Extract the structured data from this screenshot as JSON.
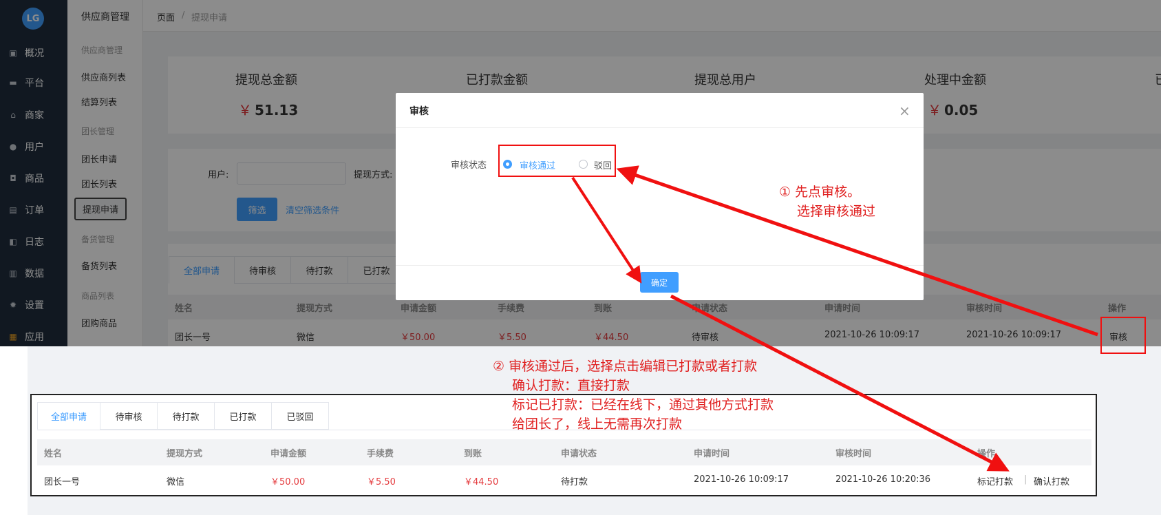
{
  "sidebar": {
    "logo_text": "LG",
    "items": [
      {
        "label": "概况",
        "icon": "monitor-icon"
      },
      {
        "label": "平台",
        "icon": "desktop-icon"
      },
      {
        "label": "商家",
        "icon": "store-icon"
      },
      {
        "label": "用户",
        "icon": "user-icon"
      },
      {
        "label": "商品",
        "icon": "goods-icon"
      },
      {
        "label": "订单",
        "icon": "order-icon"
      },
      {
        "label": "日志",
        "icon": "log-icon"
      },
      {
        "label": "数据",
        "icon": "chart-icon"
      },
      {
        "label": "设置",
        "icon": "gear-icon"
      },
      {
        "label": "应用",
        "icon": "apps-icon"
      }
    ]
  },
  "subnav": {
    "title": "供应商管理",
    "groups": [
      {
        "label": "供应商管理",
        "items": [
          "供应商列表",
          "结算列表"
        ]
      },
      {
        "label": "团长管理",
        "items": [
          "团长申请",
          "团长列表",
          "提现申请"
        ]
      },
      {
        "label": "备货管理",
        "items": [
          "备货列表"
        ]
      },
      {
        "label": "商品列表",
        "items": [
          "团购商品"
        ]
      }
    ],
    "active": "提现申请"
  },
  "breadcrumb": {
    "root": "页面",
    "sep": "/",
    "current": "提现申请"
  },
  "stats": [
    {
      "label": "提现总金额",
      "currency": "￥",
      "value": "51.13"
    },
    {
      "label": "已打款金额"
    },
    {
      "label": "提现总用户"
    },
    {
      "label": "处理中金额",
      "currency": "￥",
      "value": "0.05"
    },
    {
      "label": "已"
    }
  ],
  "filter": {
    "user_label": "用户:",
    "method_label": "提现方式:",
    "filter_button": "筛选",
    "clear_link": "清空筛选条件"
  },
  "tabs": [
    "全部申请",
    "待审核",
    "待打款",
    "已打款",
    "已驳回"
  ],
  "table": {
    "headers": [
      "姓名",
      "提现方式",
      "申请金额",
      "手续费",
      "到账",
      "申请状态",
      "申请时间",
      "审核时间",
      "操作"
    ],
    "row_top": {
      "name": "团长一号",
      "method": "微信",
      "amount": "￥50.00",
      "fee": "￥5.50",
      "received": "￥44.50",
      "status": "待审核",
      "apply_time": "2021-10-26 10:09:17",
      "review_time": "2021-10-26 10:09:17",
      "action": "审核"
    },
    "row_bottom": {
      "name": "团长一号",
      "method": "微信",
      "amount": "￥50.00",
      "fee": "￥5.50",
      "received": "￥44.50",
      "status": "待打款",
      "apply_time": "2021-10-26 10:09:17",
      "review_time": "2021-10-26 10:20:36",
      "action_mark": "标记打款",
      "action_sep": "|",
      "action_confirm": "确认打款"
    }
  },
  "dialog": {
    "title": "审核",
    "close": "×",
    "field_label": "审核状态",
    "option_approve": "审核通过",
    "option_reject": "驳回",
    "confirm": "确定"
  },
  "annotations": {
    "step1_line1": "① 先点审核。",
    "step1_line2": "选择审核通过",
    "step2_line1": "② 审核通过后，选择点击编辑已打款或者打款",
    "step2_line2": "确认打款：直接打款",
    "step2_line3": "标记已打款：已经在线下，通过其他方式打款",
    "step2_line4": "给团长了，线上无需再次打款"
  },
  "colors": {
    "primary": "#409eff",
    "sidebar": "#1f2d3d",
    "price": "#e4393c",
    "annotation": "#e02020"
  }
}
